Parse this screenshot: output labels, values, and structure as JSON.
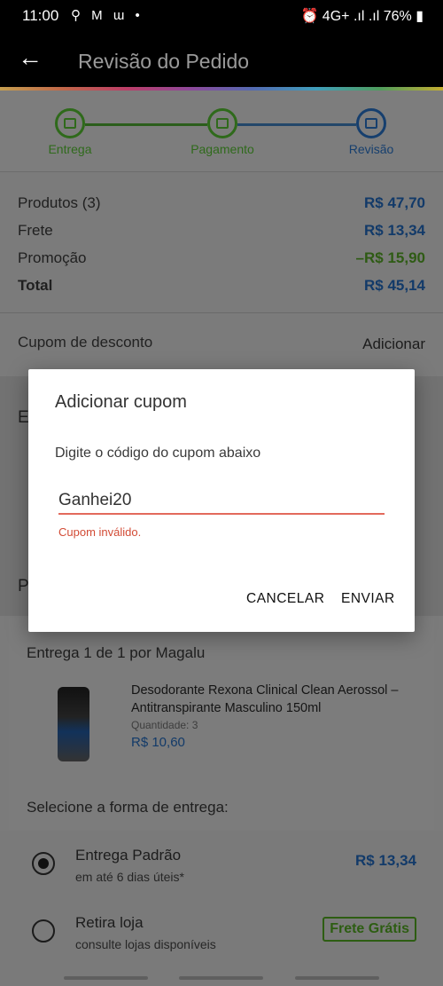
{
  "status_bar": {
    "time": "11:00",
    "left_icons": "⚲ M ɯ •",
    "right": "⏰ 4G+ .ıl .ıl 76% ▮"
  },
  "app_bar": {
    "back_icon": "arrow-left",
    "title": "Revisão do Pedido"
  },
  "steps": [
    {
      "label": "Entrega",
      "state": "done",
      "icon": "truck"
    },
    {
      "label": "Pagamento",
      "state": "done",
      "icon": "card"
    },
    {
      "label": "Revisão",
      "state": "current",
      "icon": "list"
    }
  ],
  "summary": {
    "products_label": "Produtos (3)",
    "products_value": "R$ 47,70",
    "shipping_label": "Frete",
    "shipping_value": "R$ 13,34",
    "promo_label": "Promoção",
    "promo_value": "–R$ 15,90",
    "total_label": "Total",
    "total_value": "R$ 45,14"
  },
  "coupon": {
    "label": "Cupom de desconto",
    "action": "Adicionar"
  },
  "partial_headers": {
    "first": "E",
    "second": "P"
  },
  "order": {
    "delivery_title": "Entrega 1 de 1 por Magalu",
    "product_name": "Desodorante Rexona Clinical Clean Aerossol – Antitranspirante Masculino 150ml",
    "product_qty": "Quantidade:  3",
    "product_price": "R$ 10,60",
    "select_title": "Selecione a forma de entrega:",
    "options": [
      {
        "title": "Entrega Padrão",
        "subtitle": "em até 6 dias úteis*",
        "price": "R$ 13,34",
        "selected": true
      },
      {
        "title": "Retira loja",
        "subtitle": "consulte lojas disponíveis",
        "badge": "Frete Grátis",
        "selected": false
      }
    ]
  },
  "dialog": {
    "title": "Adicionar cupom",
    "subtitle": "Digite o código do cupom abaixo",
    "input_value": "Ganhei20",
    "error": "Cupom inválido.",
    "cancel_label": "CANCELAR",
    "submit_label": "ENVIAR"
  },
  "colors": {
    "accent_blue": "#0086ff",
    "accent_green": "#56b42b",
    "error_red": "#e45a46"
  }
}
